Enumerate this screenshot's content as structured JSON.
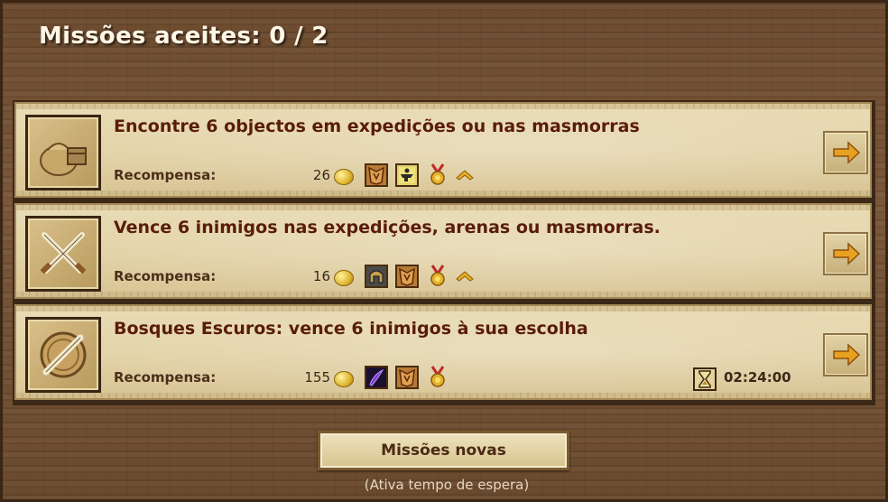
{
  "header": {
    "title": "Missões aceites: 0 / 2"
  },
  "quests": [
    {
      "icon": "loot-bag-icon",
      "text": "Encontre 6 objectos em expedições ou nas masmorras",
      "reward_label": "Recompensa:",
      "gold": "26",
      "rewards": [
        "armor-icon",
        "anvil-icon",
        "medal-icon",
        "chevron-rank-icon"
      ]
    },
    {
      "icon": "crossed-swords-icon",
      "text": "Vence 6 inimigos nas expedições, arenas ou masmorras.",
      "reward_label": "Recompensa:",
      "gold": "16",
      "rewards": [
        "helmet-icon",
        "armor-icon",
        "medal-icon",
        "chevron-rank-icon"
      ]
    },
    {
      "icon": "sword-shield-icon",
      "text": "Bosques Escuros: vence 6 inimigos à sua escolha",
      "reward_label": "Recompensa:",
      "gold": "155",
      "rewards": [
        "dark-blade-icon",
        "armor-icon",
        "medal-icon"
      ],
      "timer": "02:24:00"
    }
  ],
  "footer": {
    "new_button": "Missões novas",
    "note": "(Ativa tempo de espera)"
  },
  "colors": {
    "quest_text": "#5a1c0a",
    "arrow": "#e8a020",
    "wood": "#6b4a2f"
  }
}
